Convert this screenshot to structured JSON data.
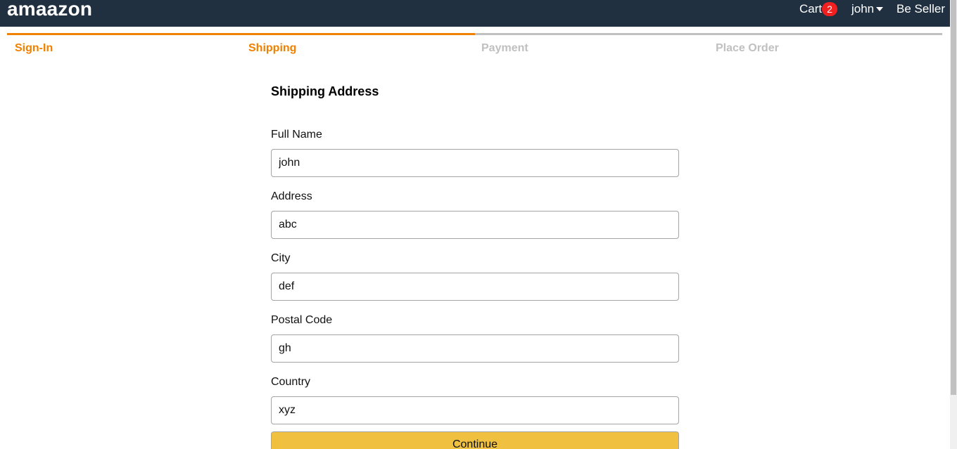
{
  "header": {
    "brand": "amaazon",
    "cart_label": "Cart",
    "cart_count": "2",
    "user_name": "john",
    "seller_label": "Be Seller"
  },
  "checkout_steps": [
    {
      "label": "Sign-In",
      "active": true
    },
    {
      "label": "Shipping",
      "active": true
    },
    {
      "label": "Payment",
      "active": false
    },
    {
      "label": "Place Order",
      "active": false
    }
  ],
  "form": {
    "title": "Shipping Address",
    "fields": [
      {
        "label": "Full Name",
        "value": "john"
      },
      {
        "label": "Address",
        "value": "abc"
      },
      {
        "label": "City",
        "value": "def"
      },
      {
        "label": "Postal Code",
        "value": "gh"
      },
      {
        "label": "Country",
        "value": "xyz"
      }
    ],
    "submit_label": "Continue"
  },
  "colors": {
    "header_bg": "#203040",
    "accent": "#f08000",
    "inactive": "#c0c0c0",
    "badge": "#f02020",
    "button": "#f0c040"
  },
  "icons": {
    "user_menu": "caret-down-icon"
  }
}
